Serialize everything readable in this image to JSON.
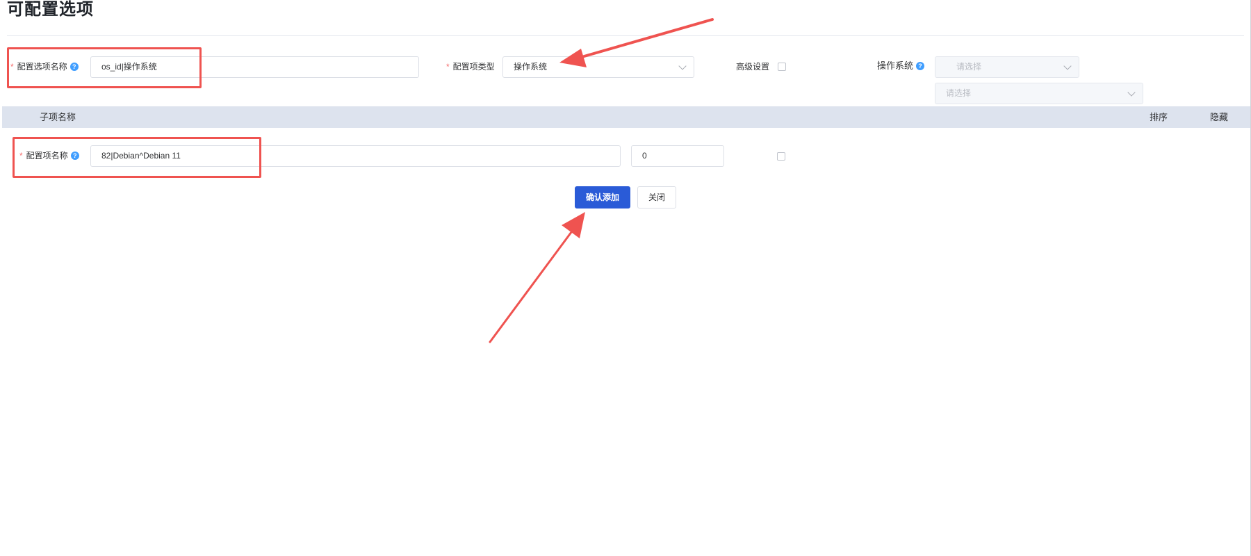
{
  "page": {
    "title": "可配置选项"
  },
  "form": {
    "option_name": {
      "label": "配置选项名称",
      "help": "?",
      "value": "os_id|操作系统"
    },
    "option_type": {
      "label": "配置项类型",
      "value": "操作系统"
    },
    "advanced": {
      "label": "高级设置"
    },
    "os": {
      "label": "操作系统",
      "help": "?",
      "select1_placeholder": "请选择",
      "select2_placeholder": "请选择"
    }
  },
  "table": {
    "columns": {
      "sub_name": "子项名称",
      "sort": "排序",
      "hidden": "隐藏"
    },
    "rows": [
      {
        "label": "配置项名称",
        "help": "?",
        "name_value": "82|Debian^Debian 11",
        "sort_value": "0"
      }
    ]
  },
  "actions": {
    "confirm": "确认添加",
    "close": "关闭"
  },
  "colors": {
    "primary": "#2a5bd7",
    "annotation": "#ef5350",
    "header_bg": "#dde3ee",
    "required": "#f56c6c",
    "help": "#409eff"
  }
}
